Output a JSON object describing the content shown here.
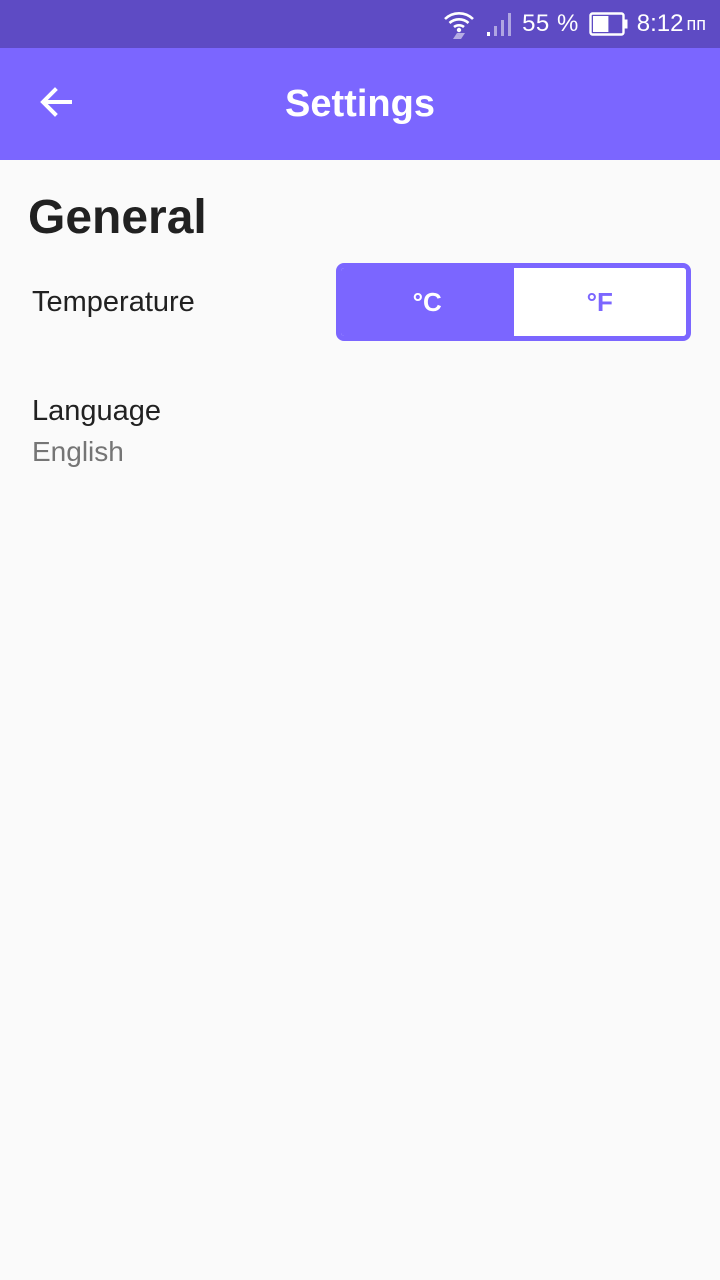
{
  "status_bar": {
    "battery_percent": "55 %",
    "time": "8:12",
    "time_suffix": "пп",
    "battery_level": 0.55,
    "icons": [
      "wifi-icon",
      "signal-icon",
      "battery-icon"
    ]
  },
  "app_bar": {
    "title": "Settings",
    "back_icon": "arrow-left-icon",
    "color": "#7b66ff"
  },
  "section": {
    "title": "General"
  },
  "temperature": {
    "label": "Temperature",
    "options": [
      "°C",
      "°F"
    ],
    "selected": "°C"
  },
  "language": {
    "label": "Language",
    "value": "English"
  },
  "colors": {
    "accent": "#7b66ff",
    "status_bar": "#5e4bc4"
  }
}
